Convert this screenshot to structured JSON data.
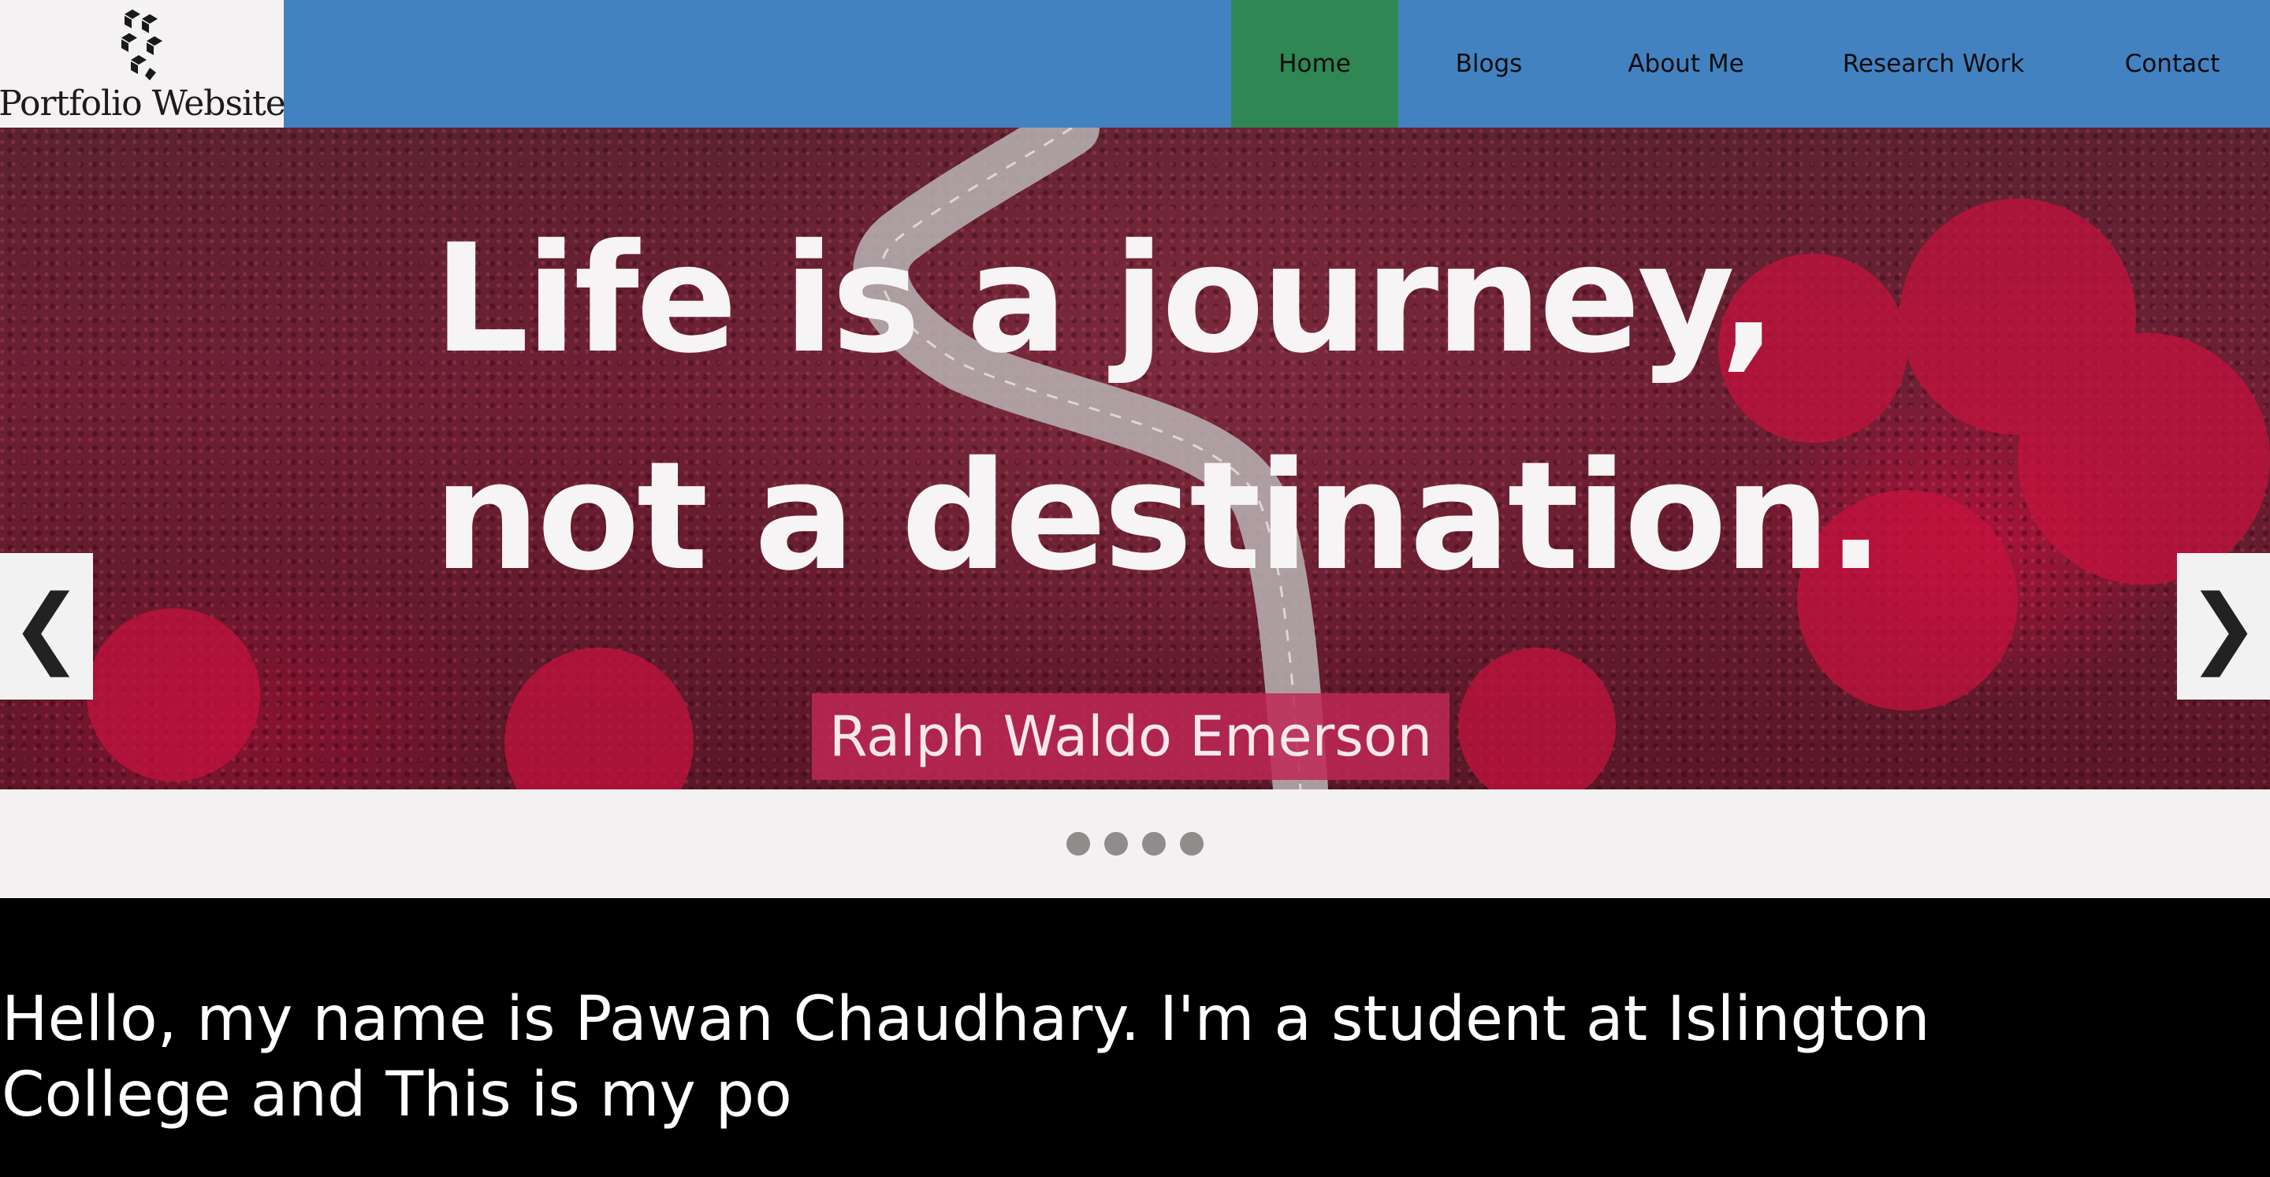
{
  "logo": {
    "text": "Portfolio Website",
    "icon": "cube-stack-logo-icon"
  },
  "nav": {
    "items": [
      {
        "label": "Home",
        "active": true
      },
      {
        "label": "Blogs",
        "active": false
      },
      {
        "label": "About Me",
        "active": false
      },
      {
        "label": "Research Work",
        "active": false
      },
      {
        "label": "Contact",
        "active": false
      }
    ]
  },
  "hero": {
    "quote_line1": "Life is a journey,",
    "quote_line2": "not a destination.",
    "author": "Ralph Waldo Emerson",
    "prev_icon": "chevron-left-icon",
    "next_icon": "chevron-right-icon",
    "prev_glyph": "❮",
    "next_glyph": "❯"
  },
  "slideshow": {
    "dot_count": 4
  },
  "intro": {
    "text": "Hello, my name is Pawan Chaudhary. I'm a student at Islington College and This is my po"
  },
  "colors": {
    "header": "#4282c1",
    "active_nav": "#2f8754",
    "author_bg": "#be2855",
    "page_bg": "#000000"
  }
}
